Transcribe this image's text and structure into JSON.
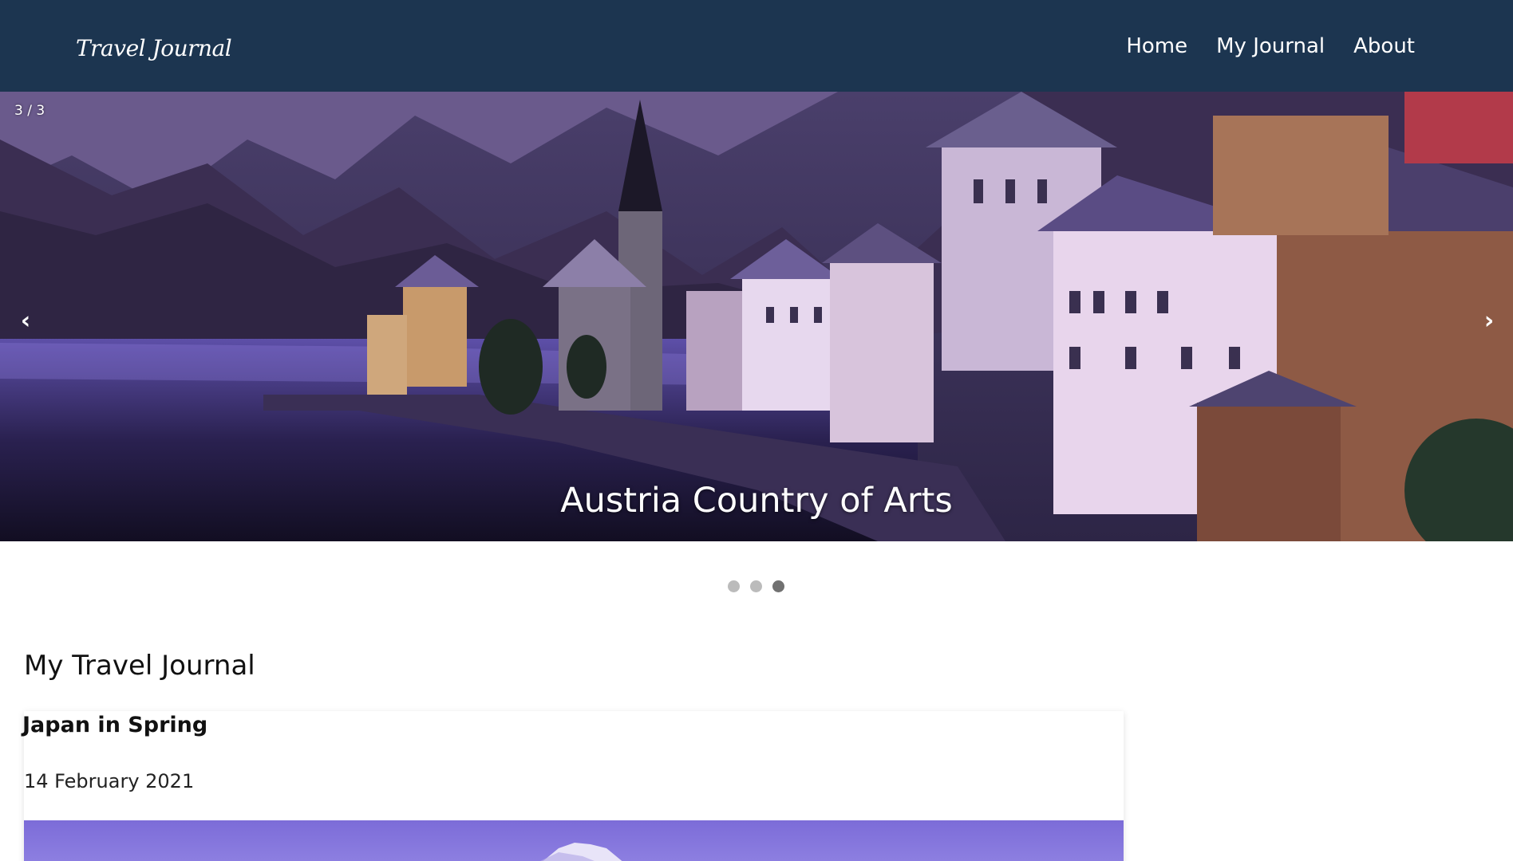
{
  "header": {
    "brand": "Travel Journal",
    "nav": [
      {
        "label": "Home"
      },
      {
        "label": "My Journal"
      },
      {
        "label": "About"
      }
    ]
  },
  "slideshow": {
    "counter": "3 / 3",
    "caption": "Austria Country of Arts",
    "prev_icon": "‹",
    "next_icon": "›",
    "slide_count": 3,
    "active_slide": 3
  },
  "journal": {
    "title": "My Travel Journal",
    "entries": [
      {
        "title": "Japan in Spring",
        "date": "14 February 2021"
      }
    ]
  },
  "colors": {
    "navbar": "#1c3550",
    "dot_inactive": "#bbbbbb",
    "dot_active": "#717171"
  }
}
